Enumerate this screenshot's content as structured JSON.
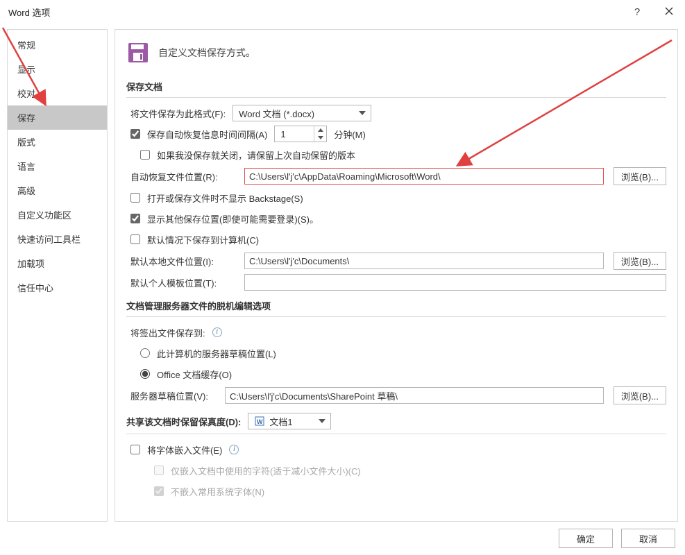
{
  "window": {
    "title": "Word 选项",
    "help": "?",
    "close_icon": "close"
  },
  "sidebar": {
    "items": [
      {
        "label": "常规"
      },
      {
        "label": "显示"
      },
      {
        "label": "校对"
      },
      {
        "label": "保存"
      },
      {
        "label": "版式"
      },
      {
        "label": "语言"
      },
      {
        "label": "高级"
      },
      {
        "label": "自定义功能区"
      },
      {
        "label": "快速访问工具栏"
      },
      {
        "label": "加载项"
      },
      {
        "label": "信任中心"
      }
    ],
    "selected_index": 3
  },
  "header": {
    "text": "自定义文档保存方式。",
    "icon": "save-floppy"
  },
  "section_save_docs": {
    "title": "保存文档"
  },
  "save_format": {
    "label": "将文件保存为此格式(F):",
    "value": "Word 文档 (*.docx)"
  },
  "autosave": {
    "checkbox_label": "保存自动恢复信息时间间隔(A)",
    "checked": true,
    "interval_value": "1",
    "minutes_label": "分钟(M)"
  },
  "keep_last": {
    "checkbox_label": "如果我没保存就关闭，请保留上次自动保留的版本",
    "checked": false
  },
  "autorecover_path": {
    "label": "自动恢复文件位置(R):",
    "value": "C:\\Users\\l'j'c\\AppData\\Roaming\\Microsoft\\Word\\",
    "browse": "浏览(B)..."
  },
  "no_backstage": {
    "label": "打开或保存文件时不显示 Backstage(S)",
    "checked": false
  },
  "show_other_locations": {
    "label": "显示其他保存位置(即使可能需要登录)(S)。",
    "checked": true
  },
  "default_save_computer": {
    "label": "默认情况下保存到计算机(C)",
    "checked": false
  },
  "default_local_path": {
    "label": "默认本地文件位置(I):",
    "value": "C:\\Users\\l'j'c\\Documents\\",
    "browse": "浏览(B)..."
  },
  "default_template_path": {
    "label": "默认个人模板位置(T):",
    "value": ""
  },
  "section_offline_edit": {
    "title": "文档管理服务器文件的脱机编辑选项"
  },
  "checkout_to": {
    "label": "将签出文件保存到:",
    "info": "i",
    "option_server_draft": "此计算机的服务器草稿位置(L)",
    "option_office_cache": "Office 文档缓存(O)",
    "selected": "cache"
  },
  "server_draft_path": {
    "label": "服务器草稿位置(V):",
    "value": "C:\\Users\\l'j'c\\Documents\\SharePoint 草稿\\",
    "browse": "浏览(B)..."
  },
  "section_fidelity": {
    "title": "共享该文档时保留保真度(D):",
    "doc_name": "文档1"
  },
  "embed_fonts": {
    "label": "将字体嵌入文件(E)",
    "info": "i",
    "checked": false,
    "sub_only_used": "仅嵌入文档中使用的字符(适于减小文件大小)(C)",
    "sub_only_used_checked": false,
    "sub_no_common": "不嵌入常用系统字体(N)",
    "sub_no_common_checked": true
  },
  "footer": {
    "ok": "确定",
    "cancel": "取消"
  }
}
